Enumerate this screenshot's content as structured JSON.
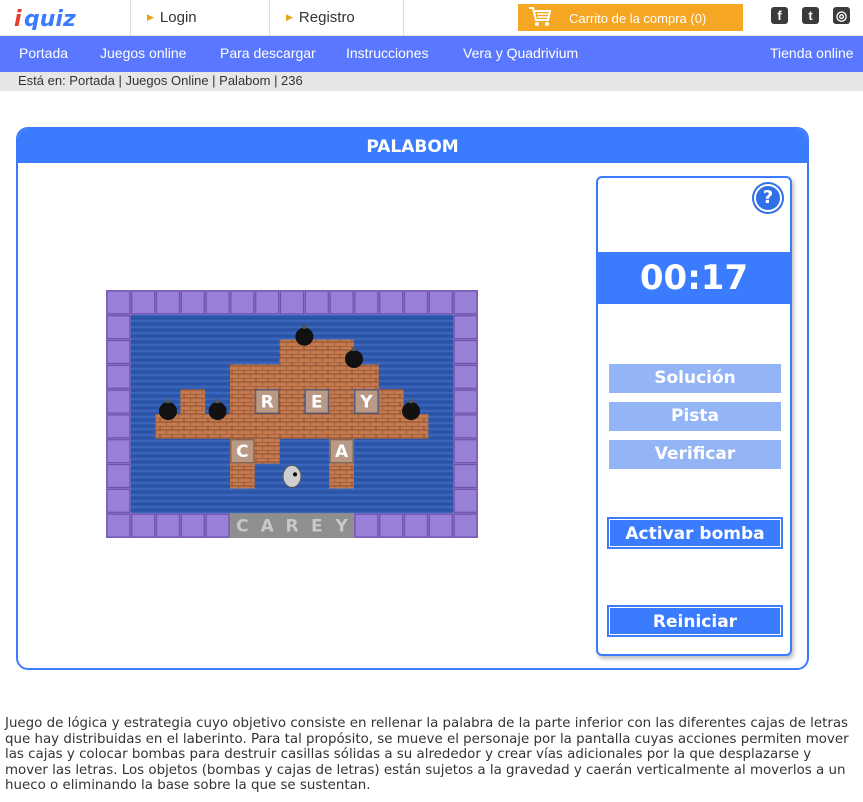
{
  "header": {
    "logo_text": "iquiz",
    "login_label": "Login",
    "register_label": "Registro",
    "cart_label": "Carrito de la compra (0)",
    "social": [
      {
        "icon": "facebook-icon",
        "glyph": "f"
      },
      {
        "icon": "twitter-icon",
        "glyph": "t"
      },
      {
        "icon": "instagram-icon",
        "glyph": "◎"
      }
    ]
  },
  "nav": {
    "items": [
      "Portada",
      "Juegos online",
      "Para descargar",
      "Instrucciones",
      "Vera y Quadrivium"
    ],
    "store": "Tienda online"
  },
  "breadcrumb": "Está en: Portada | Juegos Online | Palabom | 236",
  "game": {
    "title": "PALABOM",
    "timer": "00:17",
    "help_glyph": "?",
    "buttons": {
      "solution": "Solución",
      "hint": "Pista",
      "verify": "Verificar",
      "bomb": "Activar bomba",
      "restart": "Reiniciar"
    },
    "tiles": [
      "R",
      "E",
      "Y",
      "C",
      "A"
    ],
    "target_word": [
      "C",
      "A",
      "R",
      "E",
      "Y"
    ]
  },
  "description": "Juego de lógica y estrategia cuyo objetivo consiste en rellenar la palabra de la parte inferior con las diferentes cajas de letras que hay distribuidas en el laberinto. Para tal propósito, se mueve el personaje por la pantalla cuyas acciones permiten mover las cajas y colocar bombas para destruir casillas sólidas a su alrededor y crear vías adicionales por la que desplazarse y mover las letras. Los objetos (bombas y cajas de letras) están sujetos a la gravedad y caerán verticalmente al moverlos a un hueco o eliminando la base sobre la que se sustentan.",
  "colors": {
    "brand_blue": "#3b7cff",
    "nav_blue": "#5a78ff",
    "cart_orange": "#f5a623",
    "button_light": "#93b4f5",
    "board_wall": "#8a6fc4",
    "board_water": "#2f56a8",
    "brick": "#c8784a"
  }
}
